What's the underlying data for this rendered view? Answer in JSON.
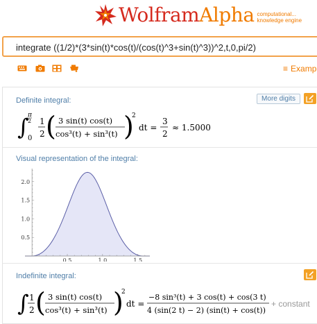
{
  "header": {
    "logo_wolfram": "Wolfram",
    "logo_alpha": "Alpha",
    "logo_tagline_1": "computational...",
    "logo_tagline_2": "knowledge engine"
  },
  "search": {
    "value": "integrate ((1/2)*(3*sin(t)*cos(t)/(cos(t)^3+sin(t)^3))^2,t,0,pi/2)"
  },
  "toolbar": {
    "icons": [
      "keyboard-icon",
      "camera-icon",
      "grid-icon",
      "mic-icon"
    ],
    "examples_label": "Examp"
  },
  "pods": {
    "definite": {
      "title": "Definite integral:",
      "more_digits_label": "More digits",
      "upper_limit": "π",
      "upper_limit_den": "2",
      "lower_limit": "0",
      "half_num": "1",
      "half_den": "2",
      "frac_num": "3 sin(t) cos(t)",
      "frac_den": "cos³(t) + sin³(t)",
      "power": "2",
      "dt": "dt =",
      "result_num": "3",
      "result_den": "2",
      "approx": "≈ 1.5000"
    },
    "visual": {
      "title": "Visual representation of the integral:"
    },
    "indefinite": {
      "title": "Indefinite integral:",
      "half_num": "1",
      "half_den": "2",
      "frac_num": "3 sin(t) cos(t)",
      "frac_den": "cos³(t) + sin³(t)",
      "power": "2",
      "dt": "dt =",
      "result_num": "−8 sin³(t) + 3 cos(t) + cos(3 t)",
      "result_den": "4 (sin(2 t) − 2) (sin(t) + cos(t))",
      "constant": "+ constant"
    }
  },
  "chart_data": {
    "type": "area",
    "title": "",
    "xlabel": "",
    "ylabel": "",
    "x_ticks": [
      "0.5",
      "1.0",
      "1.5"
    ],
    "y_ticks": [
      "0.5",
      "1.0",
      "1.5",
      "2.0"
    ],
    "xlim": [
      -0.1,
      1.67
    ],
    "ylim": [
      0,
      2.35
    ],
    "function": "(1/2)*(3 sin(t) cos(t)/(cos^3(t)+sin^3(t)))^2",
    "fill_range": [
      0,
      1.5708
    ],
    "fill_color": "#e5e6f7",
    "line_color": "#5b5fa7",
    "grid": false
  }
}
